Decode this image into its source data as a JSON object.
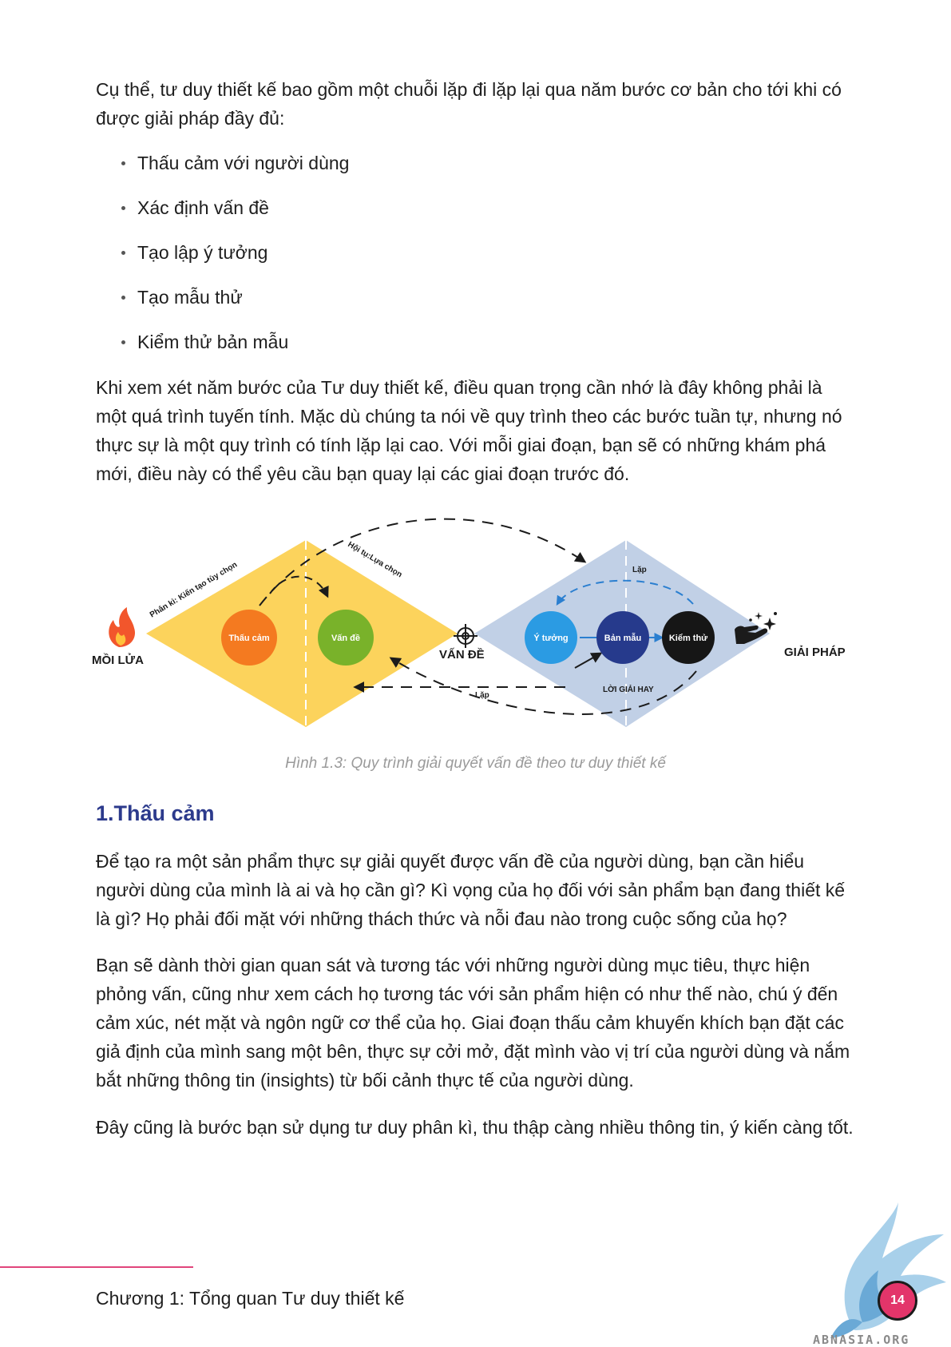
{
  "intro": "Cụ thể, tư duy thiết kế bao gồm một chuỗi lặp đi lặp lại qua năm bước cơ bản cho tới khi có được giải pháp đầy đủ:",
  "steps": [
    "Thấu cảm với người dùng",
    "Xác định vấn đề",
    "Tạo lập ý tưởng",
    "Tạo mẫu thử",
    "Kiểm thử bản mẫu"
  ],
  "para2": "Khi xem xét năm bước của Tư duy thiết kế, điều quan trọng cần nhớ là đây không phải là một quá trình tuyến tính. Mặc dù chúng ta nói về quy trình theo các bước tuần tự, nhưng nó thực sự là một quy trình có tính lặp lại cao. Với mỗi giai đoạn, bạn sẽ có những khám phá mới, điều này có thể yêu cầu bạn quay lại các giai đoạn trước đó.",
  "diagram": {
    "start_label": "MỒI LỬA",
    "problem_label": "VẤN ĐỀ",
    "solution_label": "GIẢI PHÁP",
    "diverge_label": "Phân kì: Kiến tạo tùy chọn",
    "converge_label": "Hội tụ:Lựa chọn",
    "loop_label_top": "Lặp",
    "loop_label_bottom": "Lặp",
    "answer_label": "LỜI GIẢI HAY",
    "nodes": [
      {
        "label": "Thấu cảm",
        "color": "#f47a20"
      },
      {
        "label": "Vấn đề",
        "color": "#79b22a"
      },
      {
        "label": "Ý tưởng",
        "color": "#2b9be3"
      },
      {
        "label": "Bản mẫu",
        "color": "#263a8c"
      },
      {
        "label": "Kiểm thử",
        "color": "#161616"
      }
    ],
    "left_diamond_color": "#fcd35c",
    "right_diamond_color": "#c1d0e6"
  },
  "caption": "Hình 1.3: Quy trình giải quyết vấn đề theo tư duy thiết kế",
  "section_heading": "1.Thấu cảm",
  "para3": "Để tạo ra một sản phẩm thực sự giải quyết được vấn đề của người dùng, bạn cần hiểu người dùng của mình là ai và họ cần gì? Kì vọng của họ đối với sản phẩm bạn đang thiết kế là gì? Họ phải đối mặt với những thách thức và nỗi đau nào trong cuộc sống của họ?",
  "para4": "Bạn sẽ dành thời gian quan sát và tương tác với những người dùng mục tiêu, thực hiện phỏng vấn, cũng như xem cách họ tương tác với sản phẩm hiện có như thế nào, chú ý đến cảm xúc, nét mặt và ngôn ngữ cơ thể của họ. Giai đoạn thấu cảm khuyến khích bạn đặt các giả định của mình sang một bên, thực sự cởi mở, đặt mình vào vị trí của người dùng và nắm bắt những thông tin (insights) từ bối cảnh thực tế của người dùng.",
  "para5": "Đây cũng là bước bạn sử dụng tư duy phân kì, thu thập càng nhiều thông tin, ý kiến càng tốt.",
  "footer": {
    "chapter": "Chương 1: Tổng quan Tư duy thiết kế",
    "page_number": "14",
    "watermark": "ABNASIA.ORG"
  }
}
